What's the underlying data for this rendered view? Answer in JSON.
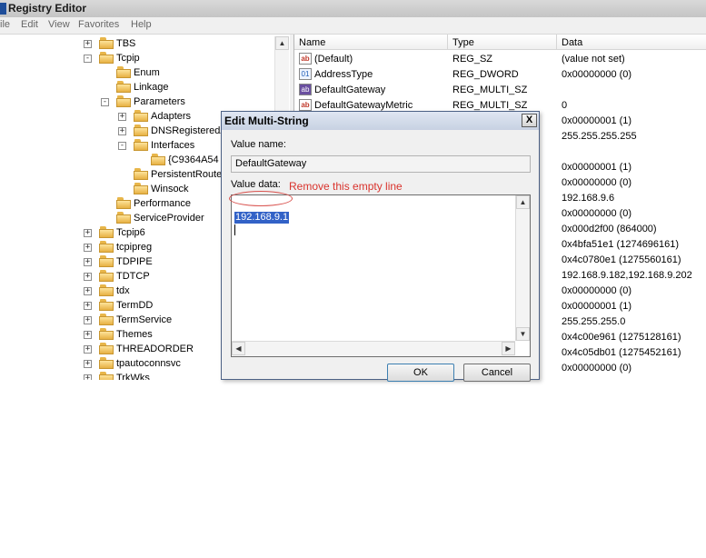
{
  "window": {
    "title": "Registry Editor"
  },
  "menu": [
    "ile",
    "Edit",
    "View",
    "Favorites",
    "Help"
  ],
  "tree": [
    {
      "label": "TBS",
      "expander": "+"
    },
    {
      "label": "Tcpip",
      "expander": "-"
    },
    {
      "label": "Enum",
      "expander": ""
    },
    {
      "label": "Linkage",
      "expander": ""
    },
    {
      "label": "Parameters",
      "expander": "-"
    },
    {
      "label": "Adapters",
      "expander": "+"
    },
    {
      "label": "DNSRegisteredA",
      "expander": "+"
    },
    {
      "label": "Interfaces",
      "expander": "-"
    },
    {
      "label": "{C9364A54",
      "expander": ""
    },
    {
      "label": "PersistentRoute",
      "expander": ""
    },
    {
      "label": "Winsock",
      "expander": ""
    },
    {
      "label": "Performance",
      "expander": ""
    },
    {
      "label": "ServiceProvider",
      "expander": ""
    },
    {
      "label": "Tcpip6",
      "expander": "+"
    },
    {
      "label": "tcpipreg",
      "expander": "+"
    },
    {
      "label": "TDPIPE",
      "expander": "+"
    },
    {
      "label": "TDTCP",
      "expander": "+"
    },
    {
      "label": "tdx",
      "expander": "+"
    },
    {
      "label": "TermDD",
      "expander": "+"
    },
    {
      "label": "TermService",
      "expander": "+"
    },
    {
      "label": "Themes",
      "expander": "+"
    },
    {
      "label": "THREADORDER",
      "expander": "+"
    },
    {
      "label": "tpautoconnsvc",
      "expander": "+"
    },
    {
      "label": "TrkWks",
      "expander": "+"
    }
  ],
  "list": {
    "columns": [
      "Name",
      "Type",
      "Data"
    ],
    "rows": [
      {
        "icon": "string-value-icon",
        "name": "(Default)",
        "type": "REG_SZ",
        "data": "(value not set)"
      },
      {
        "icon": "binary-value-icon",
        "name": "AddressType",
        "type": "REG_DWORD",
        "data": "0x00000000 (0)"
      },
      {
        "icon": "multistring-value-icon",
        "name": "DefaultGateway",
        "type": "REG_MULTI_SZ",
        "data": ""
      },
      {
        "icon": "string-value-icon",
        "name": "DefaultGatewayMetric",
        "type": "REG_MULTI_SZ",
        "data": "0"
      },
      {
        "icon": "",
        "name": "",
        "type": "",
        "data": "0x00000001 (1)"
      },
      {
        "icon": "",
        "name": "",
        "type": "",
        "data": "255.255.255.255"
      },
      {
        "icon": "",
        "name": "",
        "type": "",
        "data": ""
      },
      {
        "icon": "",
        "name": "",
        "type": "",
        "data": "0x00000001 (1)"
      },
      {
        "icon": "",
        "name": "",
        "type": "",
        "data": "0x00000000 (0)"
      },
      {
        "icon": "",
        "name": "",
        "type": "",
        "data": "192.168.9.6"
      },
      {
        "icon": "",
        "name": "",
        "type": "",
        "data": "0x00000000 (0)"
      },
      {
        "icon": "",
        "name": "",
        "type": "",
        "data": "0x000d2f00 (864000)"
      },
      {
        "icon": "",
        "name": "",
        "type": "",
        "data": "0x4bfa51e1 (1274696161)"
      },
      {
        "icon": "",
        "name": "",
        "type": "",
        "data": "0x4c0780e1 (1275560161)"
      },
      {
        "icon": "",
        "name": "",
        "type": "",
        "data": "192.168.9.182,192.168.9.202"
      },
      {
        "icon": "",
        "name": "",
        "type": "",
        "data": "0x00000000 (0)"
      },
      {
        "icon": "",
        "name": "",
        "type": "",
        "data": "0x00000001 (1)"
      },
      {
        "icon": "",
        "name": "",
        "type": "",
        "data": "255.255.255.0"
      },
      {
        "icon": "",
        "name": "",
        "type": "",
        "data": "0x4c00e961 (1275128161)"
      },
      {
        "icon": "",
        "name": "",
        "type": "",
        "data": "0x4c05db01 (1275452161)"
      },
      {
        "icon": "",
        "name": "",
        "type": "",
        "data": "0x00000000 (0)"
      }
    ]
  },
  "dialog": {
    "title": "Edit Multi-String",
    "close_glyph": "X",
    "value_name_label": "Value name:",
    "value_name": "DefaultGateway",
    "value_data_label": "Value data:",
    "value_data_selected": "192.168.9.1",
    "ok_label": "OK",
    "cancel_label": "Cancel"
  },
  "annotation": {
    "text": "Remove this empty line",
    "color": "#d9332d"
  },
  "colors": {
    "selection": "#3262c7",
    "folder": "#f2c75c",
    "dialog_border": "#4d6185"
  }
}
